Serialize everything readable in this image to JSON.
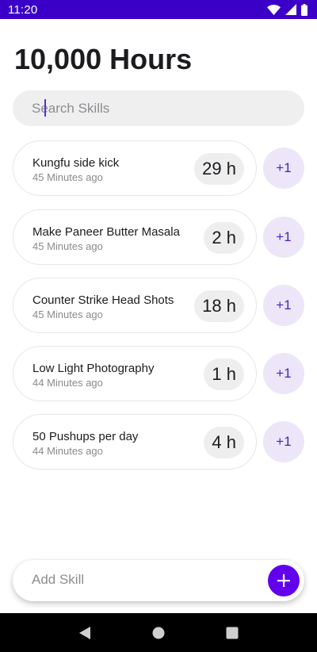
{
  "status_bar": {
    "time": "11:20",
    "icons": [
      "wifi-icon",
      "signal-icon",
      "battery-icon"
    ]
  },
  "title": "10,000 Hours",
  "search": {
    "placeholder": "Search Skills",
    "value": ""
  },
  "skills": [
    {
      "name": "Kungfu side kick",
      "time": "45 Minutes ago",
      "hours": "29 h",
      "action": "+1"
    },
    {
      "name": "Make Paneer Butter Masala",
      "time": "45 Minutes ago",
      "hours": "2 h",
      "action": "+1"
    },
    {
      "name": "Counter Strike Head Shots",
      "time": "45 Minutes ago",
      "hours": "18 h",
      "action": "+1"
    },
    {
      "name": "Low Light Photography",
      "time": "44 Minutes ago",
      "hours": "1 h",
      "action": "+1"
    },
    {
      "name": "50 Pushups per day",
      "time": "44 Minutes ago",
      "hours": "4 h",
      "action": "+1"
    }
  ],
  "add_skill": {
    "placeholder": "Add Skill",
    "value": "",
    "button_icon": "plus-icon"
  },
  "nav_bar": {
    "icons": [
      "back-icon",
      "home-icon",
      "recents-icon"
    ]
  },
  "colors": {
    "status_bar": "#3b00c8",
    "accent": "#6200ee",
    "plus_one_bg": "#ece6f8",
    "plus_one_text": "#4a1fc7",
    "search_bg": "#efeff0",
    "badge_bg": "#eeeeef"
  }
}
